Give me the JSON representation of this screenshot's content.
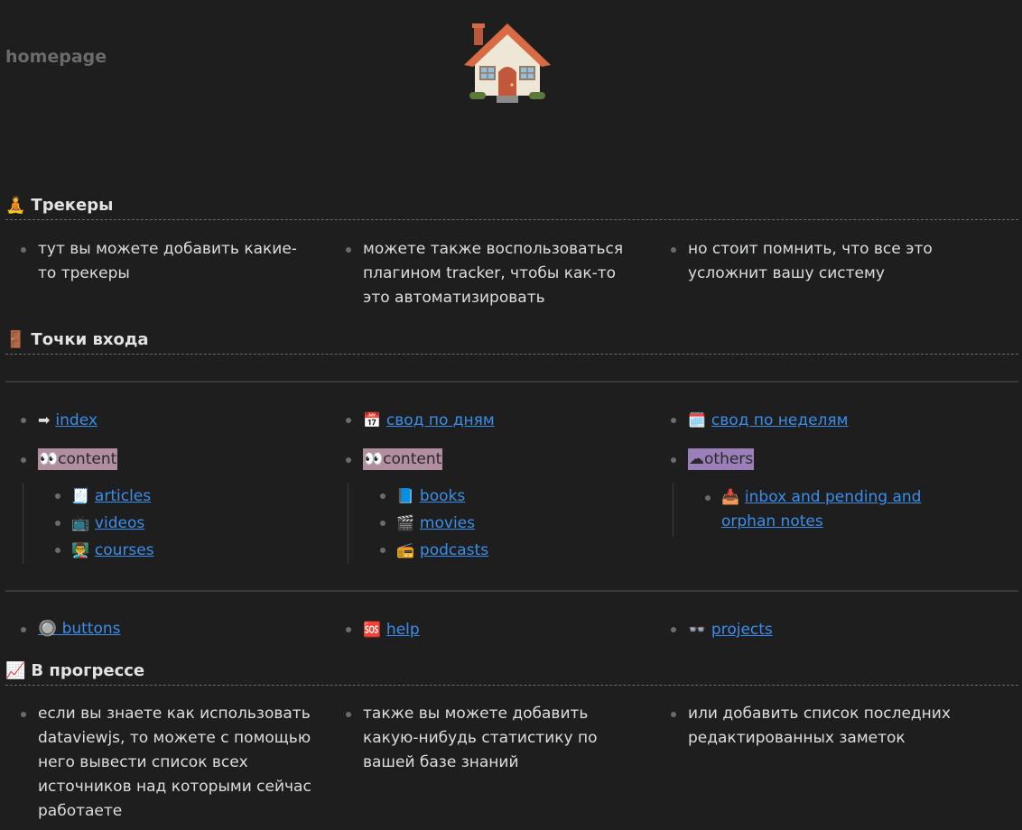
{
  "page": {
    "title": "homepage",
    "house_icon": "house-icon"
  },
  "trackers": {
    "heading_emoji": "🧘",
    "heading": "Трекеры",
    "items": [
      "тут вы можете добавить какие-то трекеры",
      "можете также воспользоваться плагином tracker, чтобы как-то это автоматизировать",
      "но стоит помнить, что все это усложнит вашу систему"
    ]
  },
  "entry_points": {
    "heading_emoji": "🚪",
    "heading": "Точки входа",
    "row1": [
      {
        "icon": "➡",
        "label": "index"
      },
      {
        "icon": "📅",
        "label": "свод по дням"
      },
      {
        "icon": "🗓️",
        "label": "свод по неделям"
      }
    ],
    "row2": [
      {
        "icon": "👀",
        "label": "content"
      },
      {
        "icon": "👀",
        "label": "content"
      },
      {
        "icon": "☁",
        "label": "others"
      }
    ],
    "sub1": [
      {
        "icon": "🧾",
        "label": "articles"
      },
      {
        "icon": "📺",
        "label": "videos"
      },
      {
        "icon": "👨‍🏫",
        "label": "courses"
      }
    ],
    "sub2": [
      {
        "icon": "📘",
        "label": "books"
      },
      {
        "icon": "🎬",
        "label": "movies"
      },
      {
        "icon": "📻",
        "label": "podcasts"
      }
    ],
    "sub3": [
      {
        "icon": "📥",
        "label": "inbox and pending and orphan notes"
      }
    ],
    "row3": [
      {
        "icon": "🔘",
        "label": "buttons"
      },
      {
        "icon": "🆘",
        "label": "help"
      },
      {
        "icon": "👓",
        "label": "projects"
      }
    ]
  },
  "progress": {
    "heading_emoji": "📈",
    "heading": "В прогрессе",
    "items": [
      "если вы знаете как использовать dataviewjs, то можете с помощью него вывести список всех источников над которыми сейчас работаете",
      "также вы можете добавить какую-нибудь статистику по вашей базе знаний",
      "или добавить список последних редактированных заметок"
    ]
  }
}
